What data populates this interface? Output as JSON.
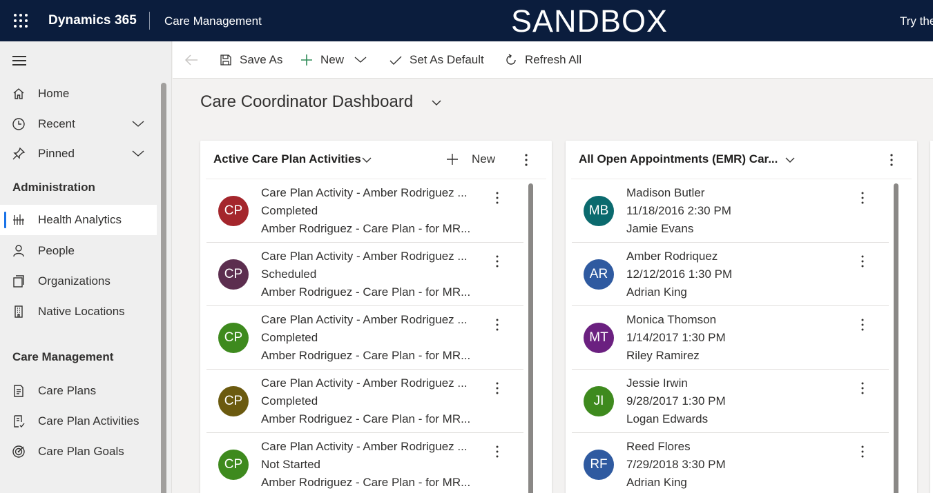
{
  "topbar": {
    "app_name": "Dynamics 365",
    "area_name": "Care Management",
    "environment_banner": "SANDBOX",
    "try_text": "Try the"
  },
  "sidebar": {
    "top_items": [
      {
        "label": "Home",
        "icon": "home-icon"
      },
      {
        "label": "Recent",
        "icon": "clock-icon"
      },
      {
        "label": "Pinned",
        "icon": "pin-icon"
      }
    ],
    "groups": [
      {
        "header": "Administration",
        "items": [
          {
            "label": "Health Analytics",
            "icon": "analytics-icon",
            "selected": true
          },
          {
            "label": "People",
            "icon": "person-icon"
          },
          {
            "label": "Organizations",
            "icon": "organization-icon"
          },
          {
            "label": "Native Locations",
            "icon": "building-icon"
          }
        ]
      },
      {
        "header": "Care Management",
        "items": [
          {
            "label": "Care Plans",
            "icon": "document-icon"
          },
          {
            "label": "Care Plan Activities",
            "icon": "activity-icon"
          },
          {
            "label": "Care Plan Goals",
            "icon": "target-icon"
          }
        ]
      }
    ]
  },
  "commandbar": {
    "save_as": "Save As",
    "new": "New",
    "set_default": "Set As Default",
    "refresh": "Refresh All"
  },
  "dashboard": {
    "title": "Care Coordinator Dashboard"
  },
  "cards": [
    {
      "title": "Active Care Plan Activities",
      "new_label": "New",
      "rows": [
        {
          "initials": "CP",
          "color": "#a4262c",
          "line1": "Care Plan Activity - Amber Rodriguez ...",
          "line2": "Completed",
          "line3": "Amber Rodriguez - Care Plan - for MR..."
        },
        {
          "initials": "CP",
          "color": "#5c2e4f",
          "line1": "Care Plan Activity - Amber Rodriguez ...",
          "line2": "Scheduled",
          "line3": "Amber Rodriguez - Care Plan - for MR..."
        },
        {
          "initials": "CP",
          "color": "#3e8a1e",
          "line1": "Care Plan Activity - Amber Rodriguez ...",
          "line2": "Completed",
          "line3": "Amber Rodriguez - Care Plan - for MR..."
        },
        {
          "initials": "CP",
          "color": "#6b5a0f",
          "line1": "Care Plan Activity - Amber Rodriguez ...",
          "line2": "Completed",
          "line3": "Amber Rodriguez - Care Plan - for MR..."
        },
        {
          "initials": "CP",
          "color": "#3e8a1e",
          "line1": "Care Plan Activity - Amber Rodriguez ...",
          "line2": "Not Started",
          "line3": "Amber Rodriguez - Care Plan - for MR..."
        }
      ]
    },
    {
      "title": "All Open Appointments (EMR) Car...",
      "rows": [
        {
          "initials": "MB",
          "color": "#0b6a6e",
          "line1": "Madison Butler",
          "line2": "11/18/2016 2:30 PM",
          "line3": "Jamie Evans"
        },
        {
          "initials": "AR",
          "color": "#2f5aa0",
          "line1": "Amber Rodriquez",
          "line2": "12/12/2016 1:30 PM",
          "line3": "Adrian King"
        },
        {
          "initials": "MT",
          "color": "#6b2080",
          "line1": "Monica Thomson",
          "line2": "1/14/2017 1:30 PM",
          "line3": "Riley Ramirez"
        },
        {
          "initials": "JI",
          "color": "#3e8a1e",
          "line1": "Jessie Irwin",
          "line2": "9/28/2017 1:30 PM",
          "line3": "Logan Edwards"
        },
        {
          "initials": "RF",
          "color": "#2f5aa0",
          "line1": "Reed Flores",
          "line2": "7/29/2018 3:30 PM",
          "line3": "Adrian King"
        }
      ]
    }
  ]
}
